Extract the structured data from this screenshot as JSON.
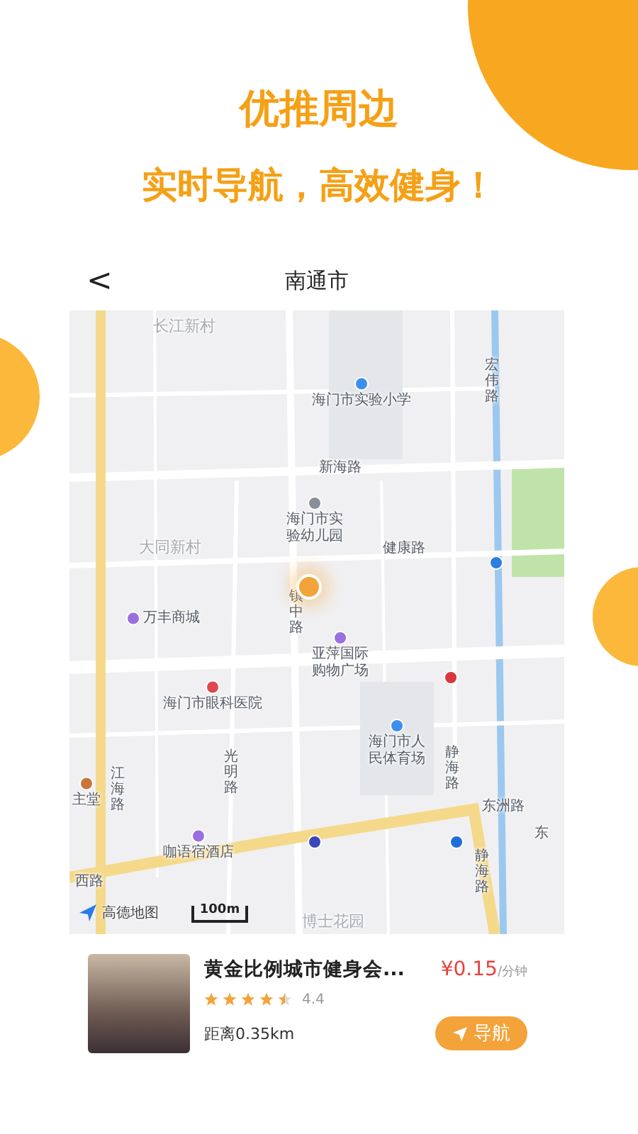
{
  "headline": "优推周边",
  "subheadline": "实时导航，高效健身！",
  "phone": {
    "back": "<",
    "title": "南通市"
  },
  "map": {
    "labels": [
      {
        "kind": "area",
        "text": "长江新村"
      },
      {
        "kind": "poi",
        "text": "海门市实验小学",
        "color": "#3d8ef0"
      },
      {
        "kind": "vroad",
        "text": "宏伟路"
      },
      {
        "kind": "road",
        "text": "新海路"
      },
      {
        "kind": "poi",
        "text": "海门市实验幼儿园",
        "color": "#8a8f99"
      },
      {
        "kind": "area",
        "text": "大同新村"
      },
      {
        "kind": "road",
        "text": "健康路"
      },
      {
        "kind": "vroad",
        "text": "镇中路"
      },
      {
        "kind": "poi-side",
        "text": "万丰商城",
        "color": "#9b6fe0"
      },
      {
        "kind": "poi",
        "text": "亚萍国际购物广场",
        "color": "#9b6fe0"
      },
      {
        "kind": "poi",
        "text": "海门市眼科医院",
        "color": "#e0474c"
      },
      {
        "kind": "poi",
        "text": "主堂",
        "color": "#c8773a"
      },
      {
        "kind": "vroad",
        "text": "光明路"
      },
      {
        "kind": "poi",
        "text": "海门市人民体育场",
        "color": "#3d8ef0"
      },
      {
        "kind": "vroad",
        "text": "静海路"
      },
      {
        "kind": "vroad",
        "text": "江海路"
      },
      {
        "kind": "road",
        "text": "东洲路"
      },
      {
        "kind": "road",
        "text": "东"
      },
      {
        "kind": "poi",
        "text": "咖语宿酒店",
        "color": "#9b6fe0"
      },
      {
        "kind": "road",
        "text": "西路"
      },
      {
        "kind": "area",
        "text": "博士花园"
      },
      {
        "kind": "vroad",
        "text": "静海路"
      },
      {
        "kind": "marker",
        "color": "#d9363e"
      },
      {
        "kind": "marker",
        "color": "#2f7de0"
      },
      {
        "kind": "marker",
        "color": "#3b47b8"
      },
      {
        "kind": "marker",
        "color": "#1f6fd6"
      }
    ],
    "logo": "高德地图",
    "scale": "100m"
  },
  "venue": {
    "name": "黄金比例城市健身会...",
    "price": "¥0.15",
    "unit": "/分钟",
    "stars": 4.5,
    "rating": "4.4",
    "distance": "距离0.35km",
    "nav": "导航"
  }
}
